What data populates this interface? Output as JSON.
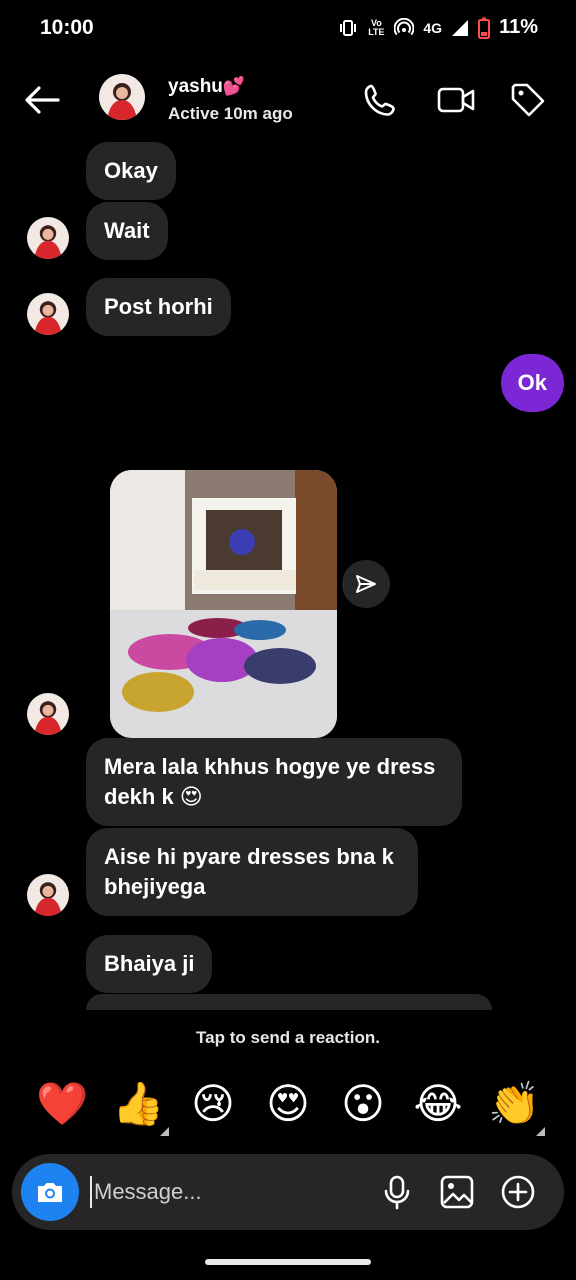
{
  "status_bar": {
    "time": "10:00",
    "network": "4G",
    "volte": "Vo LTE",
    "battery": "11%",
    "icons": [
      "vibrate-icon",
      "volte-icon",
      "hotspot-icon",
      "signal-icon",
      "battery-low-icon"
    ]
  },
  "header": {
    "contact_name": "yashu",
    "name_emoji": "💕",
    "active_status": "Active 10m ago",
    "icons": [
      "back-arrow-icon",
      "phone-icon",
      "video-camera-icon",
      "tag-icon"
    ]
  },
  "messages": [
    {
      "from": "them",
      "text": "Okay"
    },
    {
      "from": "them",
      "text": "Wait"
    },
    {
      "from": "them",
      "text": "Post horhi"
    },
    {
      "from": "me",
      "text": "Ok"
    },
    {
      "from": "them",
      "type": "photo"
    },
    {
      "from": "them",
      "text": "Mera lala khhus hogye ye dress dekh k 😍"
    },
    {
      "from": "them",
      "text": "Aise hi pyare dresses bna k bhejiyega"
    },
    {
      "from": "them",
      "text": "Bhaiya ji"
    }
  ],
  "reaction_hint": "Tap to send a reaction.",
  "reactions": [
    "❤️",
    "👍",
    "😢",
    "😍",
    "😮",
    "😂",
    "👏"
  ],
  "composer": {
    "placeholder": "Message...",
    "icons": [
      "camera-icon",
      "microphone-icon",
      "gallery-icon",
      "plus-circle-icon"
    ],
    "accent": "#1e83f0"
  },
  "colors": {
    "background": "#000000",
    "incoming_bubble": "#262626",
    "outgoing_bubble": "#7b27d6"
  }
}
